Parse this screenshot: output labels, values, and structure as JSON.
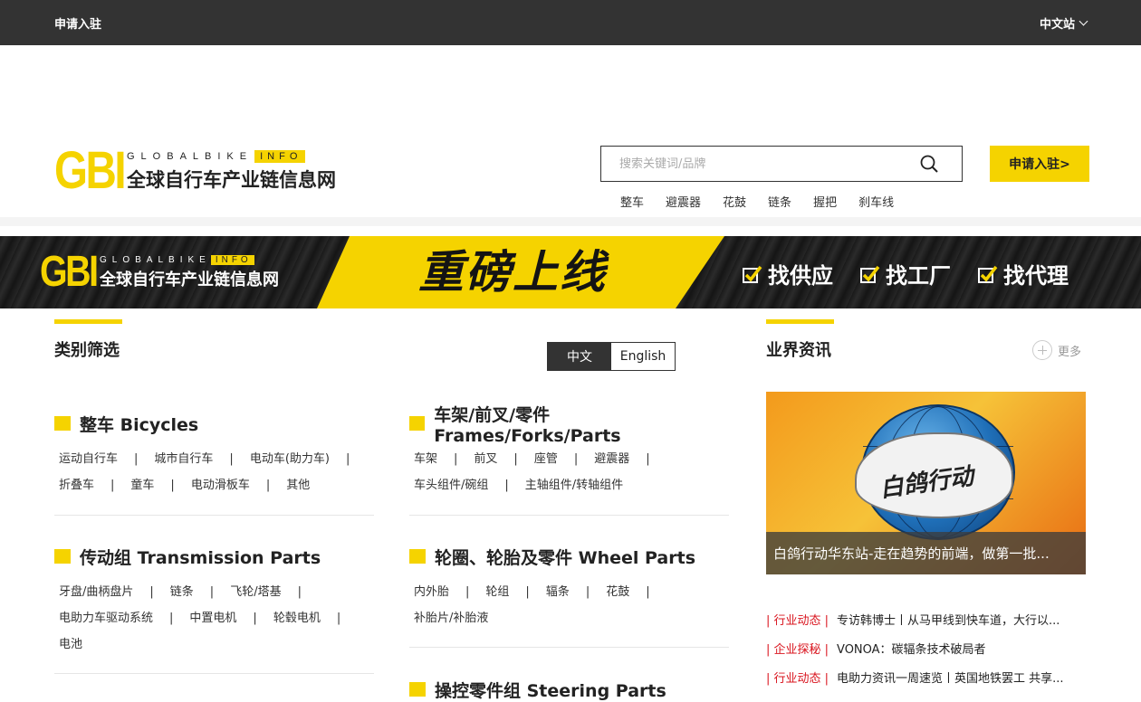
{
  "topbar": {
    "apply_label": "申请入驻",
    "site_label": "中文站"
  },
  "logo": {
    "gbi": "GBI",
    "globalbike": "GLOBALBIKE",
    "info": "INFO",
    "cn": "全球自行车产业链信息网"
  },
  "search": {
    "placeholder": "搜索关键词/品牌",
    "apply_button": "申请入驻>"
  },
  "hotwords": [
    "整车",
    "避震器",
    "花鼓",
    "链条",
    "握把",
    "刹车线"
  ],
  "banner": {
    "gbi": "GBI",
    "globalbike": "GLOBALBIKE",
    "info": "INFO",
    "cn": "全球自行车产业链信息网",
    "slogan": "重磅上线",
    "checks": [
      "找供应",
      "找工厂",
      "找代理"
    ]
  },
  "categories_section": {
    "title": "类别筛选",
    "lang_cn": "中文",
    "lang_en": "English"
  },
  "categories": [
    {
      "title": "整车 Bicycles",
      "items": [
        "运动自行车",
        "城市自行车",
        "电动车(助力车)",
        "折叠车",
        "童车",
        "电动滑板车",
        "其他"
      ]
    },
    {
      "title": "车架/前叉/零件 Frames/Forks/Parts",
      "items": [
        "车架",
        "前叉",
        "座管",
        "避震器",
        "车头组件/碗组",
        "主轴组件/转轴组件"
      ]
    },
    {
      "title": "传动组 Transmission Parts",
      "items": [
        "牙盘/曲柄盘片",
        "链条",
        "飞轮/塔基",
        "电助力车驱动系统",
        "中置电机",
        "轮毂电机",
        "电池"
      ]
    },
    {
      "title": "轮圈、轮胎及零件 Wheel Parts",
      "items": [
        "内外胎",
        "轮组",
        "辐条",
        "花鼓",
        "补胎片/补胎液"
      ]
    },
    {
      "title": "操控零件组 Steering Parts",
      "items": []
    }
  ],
  "news_section": {
    "title": "业界资讯",
    "more_label": "更多"
  },
  "featured": {
    "caption": "白鸽行动华东站-走在趋势的前端，做第一批...",
    "image_text": "白鸽行动"
  },
  "news": [
    {
      "tag": "| 行业动态 |",
      "title": "专访韩博士丨从马甲线到快车道，大行以..."
    },
    {
      "tag": "| 企业探秘 |",
      "title": "VONOA：碳辐条技术破局者"
    },
    {
      "tag": "| 行业动态 |",
      "title": "电助力资讯一周速览丨英国地铁罢工 共享..."
    }
  ],
  "colors": {
    "accent": "#f5d300",
    "topbar": "#333333",
    "news_tag": "#d9141e"
  }
}
